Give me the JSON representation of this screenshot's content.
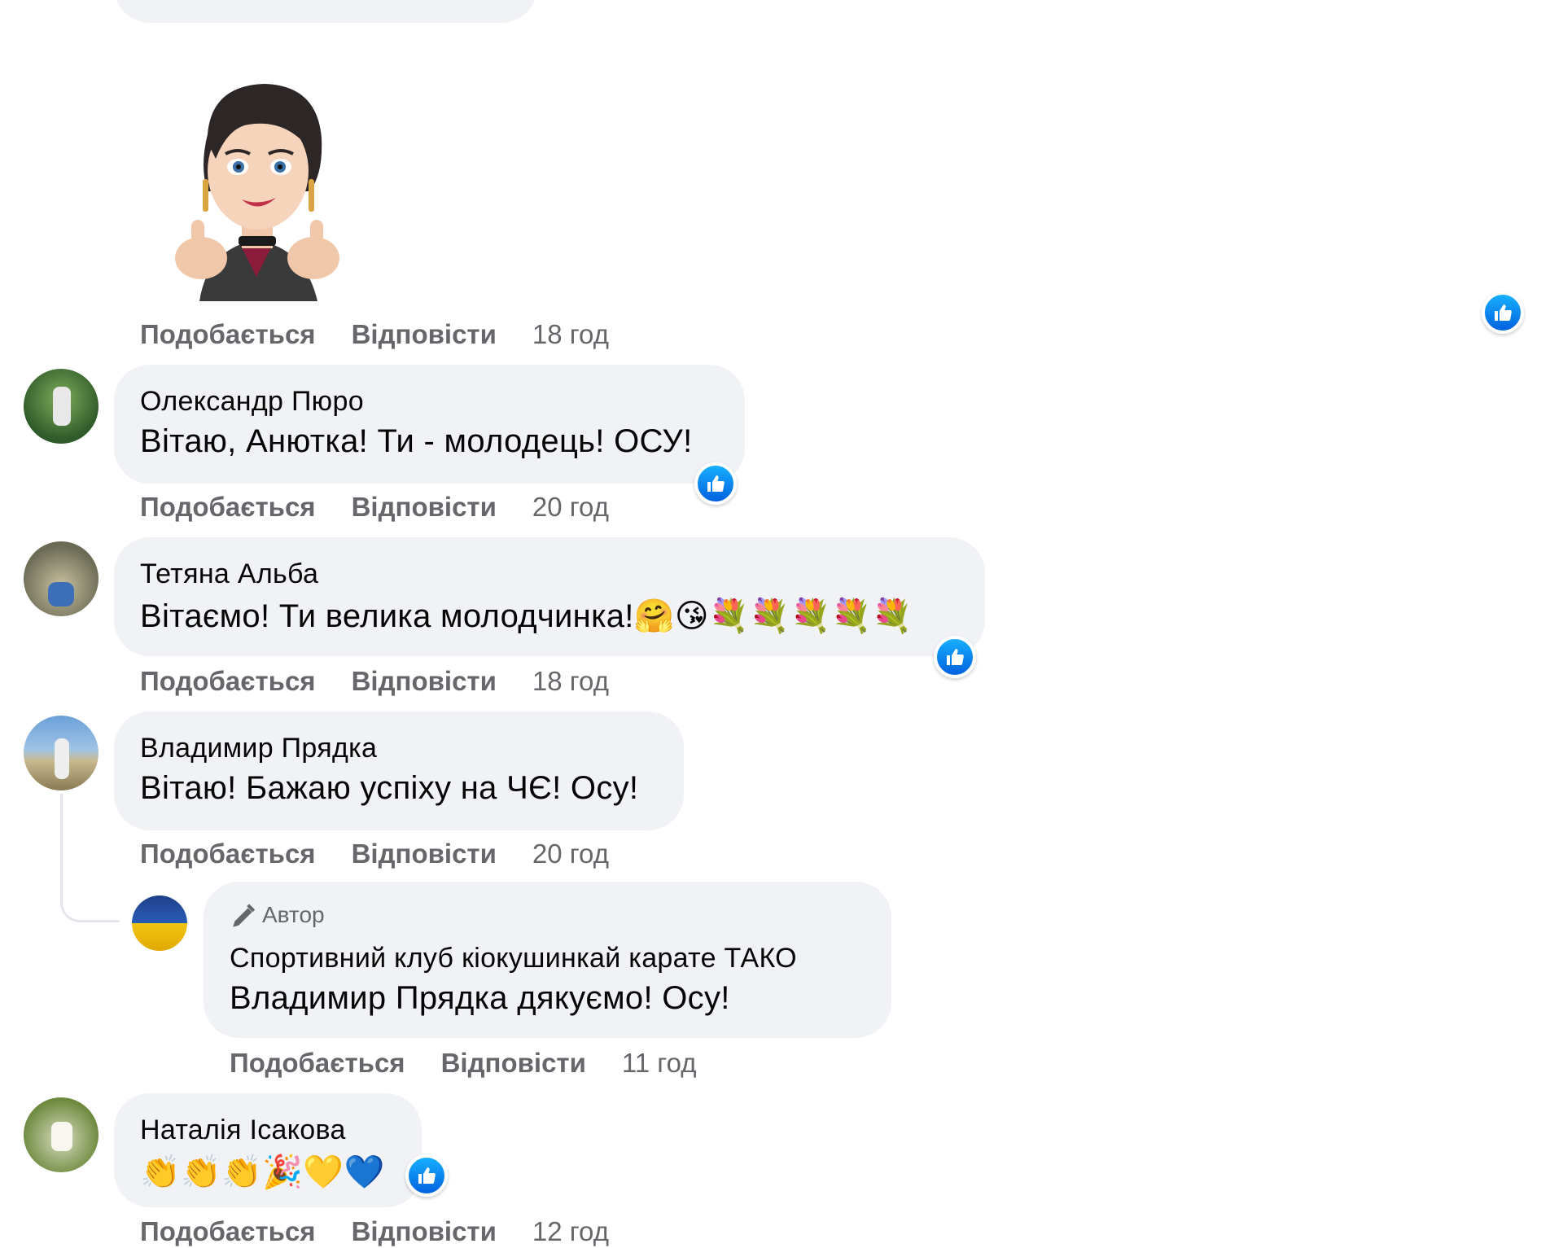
{
  "actions": {
    "like": "Подобається",
    "reply": "Відповісти"
  },
  "sticker_comment": {
    "time": "18 год"
  },
  "comments": [
    {
      "author": "Олександр Пюро",
      "text": "Вітаю, Анютка! Ти - молодець! ОСУ!",
      "time": "20 год"
    },
    {
      "author": "Тетяна Альба",
      "text": "Вітаємо! Ти велика молодчинка!",
      "emojis": "🤗😘💐💐💐💐💐",
      "time": "18 год"
    },
    {
      "author": "Владимир Прядка",
      "text": "Вітаю! Бажаю успіху на ЧЄ! Осу!",
      "time": "20 год"
    },
    {
      "author": "Наталія Ісакова",
      "emojis": "👏👏👏🎉💛💙",
      "time": "12 год"
    }
  ],
  "reply": {
    "badge": "Автор",
    "author": "Спортивний клуб кіокушинкай карате ТАКО",
    "mention": "Владимир Прядка",
    "text": " дякуємо! Осу!",
    "time": "11 год"
  },
  "colors": {
    "bubble": "#f0f2f5",
    "meta": "#65676b",
    "like_blue": "#0866ff"
  },
  "icons": [
    "like-icon",
    "pencil-icon",
    "sticker-character"
  ]
}
